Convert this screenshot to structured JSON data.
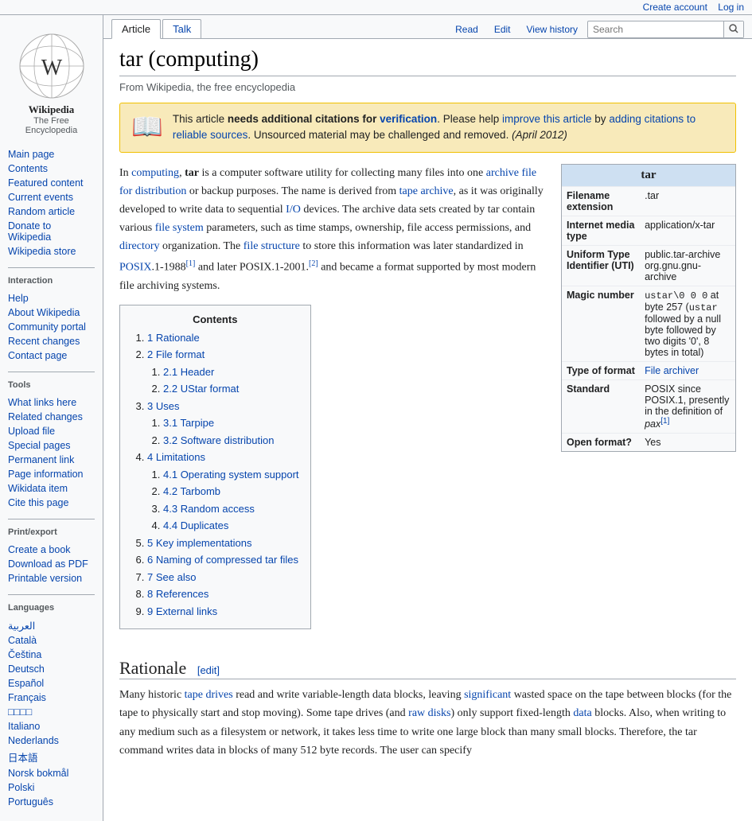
{
  "topbar": {
    "create_account": "Create account",
    "log_in": "Log in"
  },
  "sidebar": {
    "logo_text": "W",
    "logo_title": "Wikipedia",
    "logo_subtitle": "The Free Encyclopedia",
    "nav_items": [
      {
        "label": "Main page",
        "id": "main-page"
      },
      {
        "label": "Contents",
        "id": "contents"
      },
      {
        "label": "Featured content",
        "id": "featured-content"
      },
      {
        "label": "Current events",
        "id": "current-events"
      },
      {
        "label": "Random article",
        "id": "random-article"
      },
      {
        "label": "Donate to Wikipedia",
        "id": "donate"
      },
      {
        "label": "Wikipedia store",
        "id": "store"
      }
    ],
    "interaction_label": "Interaction",
    "interaction_items": [
      {
        "label": "Help",
        "id": "help"
      },
      {
        "label": "About Wikipedia",
        "id": "about"
      },
      {
        "label": "Community portal",
        "id": "community-portal"
      },
      {
        "label": "Recent changes",
        "id": "recent-changes"
      },
      {
        "label": "Contact page",
        "id": "contact"
      }
    ],
    "tools_label": "Tools",
    "tools_items": [
      {
        "label": "What links here",
        "id": "what-links"
      },
      {
        "label": "Related changes",
        "id": "related-changes"
      },
      {
        "label": "Upload file",
        "id": "upload-file"
      },
      {
        "label": "Special pages",
        "id": "special-pages"
      },
      {
        "label": "Permanent link",
        "id": "permanent-link"
      },
      {
        "label": "Page information",
        "id": "page-info"
      },
      {
        "label": "Wikidata item",
        "id": "wikidata"
      },
      {
        "label": "Cite this page",
        "id": "cite-page"
      }
    ],
    "print_label": "Print/export",
    "print_items": [
      {
        "label": "Create a book",
        "id": "create-book"
      },
      {
        "label": "Download as PDF",
        "id": "download-pdf"
      },
      {
        "label": "Printable version",
        "id": "printable"
      }
    ],
    "languages_label": "Languages",
    "languages": [
      {
        "label": "العربية"
      },
      {
        "label": "Català"
      },
      {
        "label": "Čeština"
      },
      {
        "label": "Deutsch"
      },
      {
        "label": "Español"
      },
      {
        "label": "Français"
      },
      {
        "label": "□□□□"
      },
      {
        "label": "Italiano"
      },
      {
        "label": "Nederlands"
      },
      {
        "label": "日本語"
      },
      {
        "label": "Norsk bokmål"
      },
      {
        "label": "Polski"
      },
      {
        "label": "Português"
      }
    ]
  },
  "tabs": {
    "article_label": "Article",
    "talk_label": "Talk",
    "read_label": "Read",
    "edit_label": "Edit",
    "view_history_label": "View history",
    "search_placeholder": "Search"
  },
  "article": {
    "title": "tar (computing)",
    "tagline": "From Wikipedia, the free encyclopedia",
    "notice": {
      "text_start": "This article ",
      "bold": "needs additional citations for",
      "link": "verification",
      "text_mid": ". Please help ",
      "improve_link": "improve this article",
      "text_mid2": " by ",
      "citations_link": "adding citations to reliable sources",
      "text_end": ". Unsourced material may be challenged and removed.",
      "date": "(April 2012)"
    },
    "infobox": {
      "title": "tar",
      "rows": [
        {
          "label": "Filename extension",
          "value": ".tar"
        },
        {
          "label": "Internet media type",
          "value": "application/x-tar"
        },
        {
          "label": "Uniform Type Identifier (UTI)",
          "value": "public.tar-archive org.gnu.gnu-archive"
        },
        {
          "label": "Magic number",
          "value": "ustar\\0 0 0 at byte 257 (ustar followed by a null byte followed by two digits '0', 8 bytes in total)"
        },
        {
          "label": "Type of format",
          "value": "File archiver"
        },
        {
          "label": "Standard",
          "value": "POSIX since POSIX.1, presently in the definition of pax[1]"
        },
        {
          "label": "Open format?",
          "value": "Yes"
        }
      ]
    },
    "toc_title": "Contents",
    "toc_items": [
      {
        "num": "1",
        "label": "Rationale",
        "sub": []
      },
      {
        "num": "2",
        "label": "File format",
        "sub": [
          {
            "num": "2.1",
            "label": "Header"
          },
          {
            "num": "2.2",
            "label": "UStar format"
          }
        ]
      },
      {
        "num": "3",
        "label": "Uses",
        "sub": [
          {
            "num": "3.1",
            "label": "Tarpipe"
          },
          {
            "num": "3.2",
            "label": "Software distribution"
          }
        ]
      },
      {
        "num": "4",
        "label": "Limitations",
        "sub": [
          {
            "num": "4.1",
            "label": "Operating system support"
          },
          {
            "num": "4.2",
            "label": "Tarbomb"
          },
          {
            "num": "4.3",
            "label": "Random access"
          },
          {
            "num": "4.4",
            "label": "Duplicates"
          }
        ]
      },
      {
        "num": "5",
        "label": "Key implementations",
        "sub": []
      },
      {
        "num": "6",
        "label": "Naming of compressed tar files",
        "sub": []
      },
      {
        "num": "7",
        "label": "See also",
        "sub": []
      },
      {
        "num": "8",
        "label": "References",
        "sub": []
      },
      {
        "num": "9",
        "label": "External links",
        "sub": []
      }
    ],
    "body_paragraphs": [
      "In computing, tar is a computer software utility for collecting many files into one archive file for distribution or backup purposes. The name is derived from tape archive, as it was originally developed to write data to sequential I/O devices. The archive data sets created by tar contain various file system parameters, such as time stamps, ownership, file access permissions, and directory organization. The file structure to store this information was later standardized in POSIX.1-1988[1] and later POSIX.1-2001.[2] and became a format supported by most modern file archiving systems."
    ],
    "rationale_title": "Rationale",
    "rationale_edit": "[edit]",
    "rationale_text": "Many historic tape drives read and write variable-length data blocks, leaving significant wasted space on the tape between blocks (for the tape to physically start and stop moving). Some tape drives (and raw disks) only support fixed-length data blocks. Also, when writing to any medium such as a filesystem or network, it takes less time to write one large block than many small blocks. Therefore, the tar command writes data in blocks of many 512 byte records. The user can specify"
  }
}
